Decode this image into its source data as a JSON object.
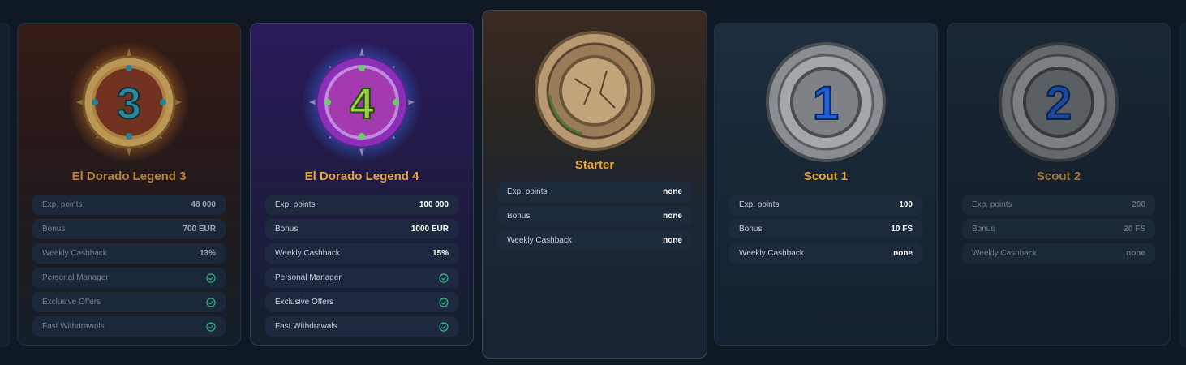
{
  "cards": [
    {
      "title": "El Dorado Legend 3",
      "medal_number": "3",
      "rows": [
        {
          "label": "Exp. points",
          "value": "48 000"
        },
        {
          "label": "Bonus",
          "value": "700 EUR"
        },
        {
          "label": "Weekly Cashback",
          "value": "13%"
        },
        {
          "label": "Personal Manager",
          "icon": "check-circle-icon"
        },
        {
          "label": "Exclusive Offers",
          "icon": "check-circle-icon"
        },
        {
          "label": "Fast Withdrawals",
          "icon": "check-circle-icon"
        }
      ]
    },
    {
      "title": "El Dorado Legend 4",
      "medal_number": "4",
      "rows": [
        {
          "label": "Exp. points",
          "value": "100 000"
        },
        {
          "label": "Bonus",
          "value": "1000 EUR"
        },
        {
          "label": "Weekly Cashback",
          "value": "15%"
        },
        {
          "label": "Personal Manager",
          "icon": "check-circle-icon"
        },
        {
          "label": "Exclusive Offers",
          "icon": "check-circle-icon"
        },
        {
          "label": "Fast Withdrawals",
          "icon": "check-circle-icon"
        }
      ]
    },
    {
      "title": "Starter",
      "medal_number": "",
      "rows": [
        {
          "label": "Exp. points",
          "value": "none"
        },
        {
          "label": "Bonus",
          "value": "none"
        },
        {
          "label": "Weekly Cashback",
          "value": "none"
        }
      ]
    },
    {
      "title": "Scout 1",
      "medal_number": "1",
      "rows": [
        {
          "label": "Exp. points",
          "value": "100"
        },
        {
          "label": "Bonus",
          "value": "10 FS"
        },
        {
          "label": "Weekly Cashback",
          "value": "none"
        }
      ]
    },
    {
      "title": "Scout 2",
      "medal_number": "2",
      "rows": [
        {
          "label": "Exp. points",
          "value": "200"
        },
        {
          "label": "Bonus",
          "value": "20 FS"
        },
        {
          "label": "Weekly Cashback",
          "value": "none"
        }
      ]
    }
  ],
  "colors": {
    "title_accent": "#e8a33a",
    "check_green": "#2fbf8a",
    "background": "#0f1923"
  }
}
